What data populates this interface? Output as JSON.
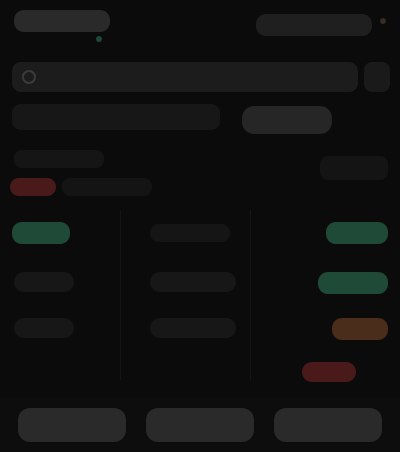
{
  "colors": {
    "background": "#0b0b0b",
    "panel": "#1c1c1c",
    "pill": "#2a2a2a",
    "green": "#1f4a37",
    "red": "#4a1a1a",
    "orange": "#4a2d1a"
  },
  "header": {
    "title": "",
    "right_pill": ""
  },
  "search": {
    "placeholder": ""
  },
  "toolbar": {
    "action_label": ""
  },
  "section": {
    "title": ""
  },
  "rows": [
    {
      "left": "",
      "middle": "",
      "right": "",
      "status": ""
    },
    {
      "left": "",
      "middle": "",
      "right": "",
      "status": ""
    },
    {
      "left": "",
      "middle": "",
      "right": "",
      "status": ""
    },
    {
      "left": "",
      "middle": "",
      "right": "",
      "status": ""
    },
    {
      "left": "",
      "middle": "",
      "right": "",
      "status": ""
    }
  ],
  "tabs": [
    {
      "label": ""
    },
    {
      "label": ""
    },
    {
      "label": ""
    }
  ]
}
